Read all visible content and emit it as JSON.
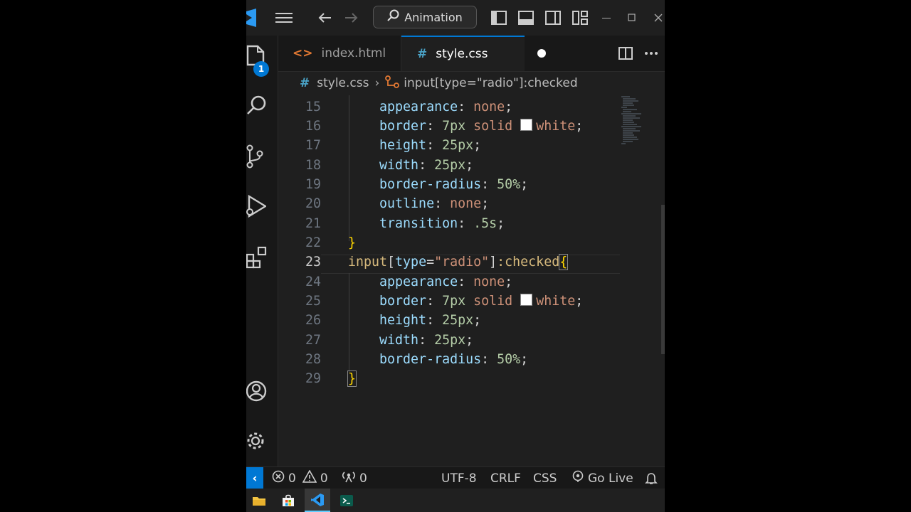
{
  "titlebar": {
    "search_label": "Animation"
  },
  "activity": {
    "explorer_badge": "1"
  },
  "tabs": [
    {
      "label": "index.html",
      "icon": "<>"
    },
    {
      "label": "style.css",
      "icon": "#"
    }
  ],
  "breadcrumb": {
    "file": "style.css",
    "symbol": "input[type=\"radio\"]:checked"
  },
  "editor": {
    "line_numbers": [
      "15",
      "16",
      "17",
      "18",
      "19",
      "20",
      "21",
      "22",
      "23",
      "24",
      "25",
      "26",
      "27",
      "28",
      "29"
    ],
    "current_line": "23"
  },
  "code": {
    "l15": {
      "p": "appearance",
      "v": "none"
    },
    "l16": {
      "p": "border",
      "n": "7px",
      "v1": "solid",
      "v2": "white"
    },
    "l17": {
      "p": "height",
      "n": "25px"
    },
    "l18": {
      "p": "width",
      "n": "25px"
    },
    "l19": {
      "p": "border-radius",
      "n": "50%"
    },
    "l20": {
      "p": "outline",
      "v": "none"
    },
    "l21": {
      "p": "transition",
      "n": ".5s"
    },
    "l22": {
      "b": "}"
    },
    "l23": {
      "tag": "input",
      "br_open": "[",
      "attr": "type",
      "eq": "=",
      "str": "\"radio\"",
      "br_close": "]",
      "pseudo": ":checked",
      "b": "{"
    },
    "l24": {
      "p": "appearance",
      "v": "none"
    },
    "l25": {
      "p": "border",
      "n": "7px",
      "v1": "solid",
      "v2": "white"
    },
    "l26": {
      "p": "height",
      "n": "25px"
    },
    "l27": {
      "p": "width",
      "n": "25px"
    },
    "l28": {
      "p": "border-radius",
      "n": "50%"
    },
    "l29": {
      "b": "}"
    }
  },
  "status": {
    "errors": "0",
    "warnings": "0",
    "ports": "0",
    "encoding": "UTF-8",
    "eol": "CRLF",
    "language": "CSS",
    "golive": "Go Live"
  },
  "colors": {
    "accent": "#0078d4",
    "editor_bg": "#1f1f1f",
    "property": "#9cdcfe",
    "value": "#ce9178",
    "number": "#b5cea8",
    "selector": "#d7ba7d"
  }
}
